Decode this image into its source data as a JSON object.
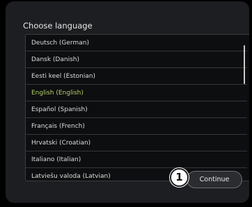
{
  "dialog": {
    "title": "Choose language"
  },
  "languages": [
    {
      "label": "Deutsch (German)",
      "selected": false
    },
    {
      "label": "Dansk (Danish)",
      "selected": false
    },
    {
      "label": "Eesti keel (Estonian)",
      "selected": false
    },
    {
      "label": "English (English)",
      "selected": true
    },
    {
      "label": "Español (Spanish)",
      "selected": false
    },
    {
      "label": "Français (French)",
      "selected": false
    },
    {
      "label": "Hrvatski (Croatian)",
      "selected": false
    },
    {
      "label": "Italiano (Italian)",
      "selected": false
    },
    {
      "label": "Latviešu valoda (Latvian)",
      "selected": false
    }
  ],
  "continue_label": "Continue",
  "callout_number": "1",
  "colors": {
    "selected_text": "#b5d16a",
    "dialog_background": "#1c1e21",
    "list_background": "#0d0e10"
  }
}
